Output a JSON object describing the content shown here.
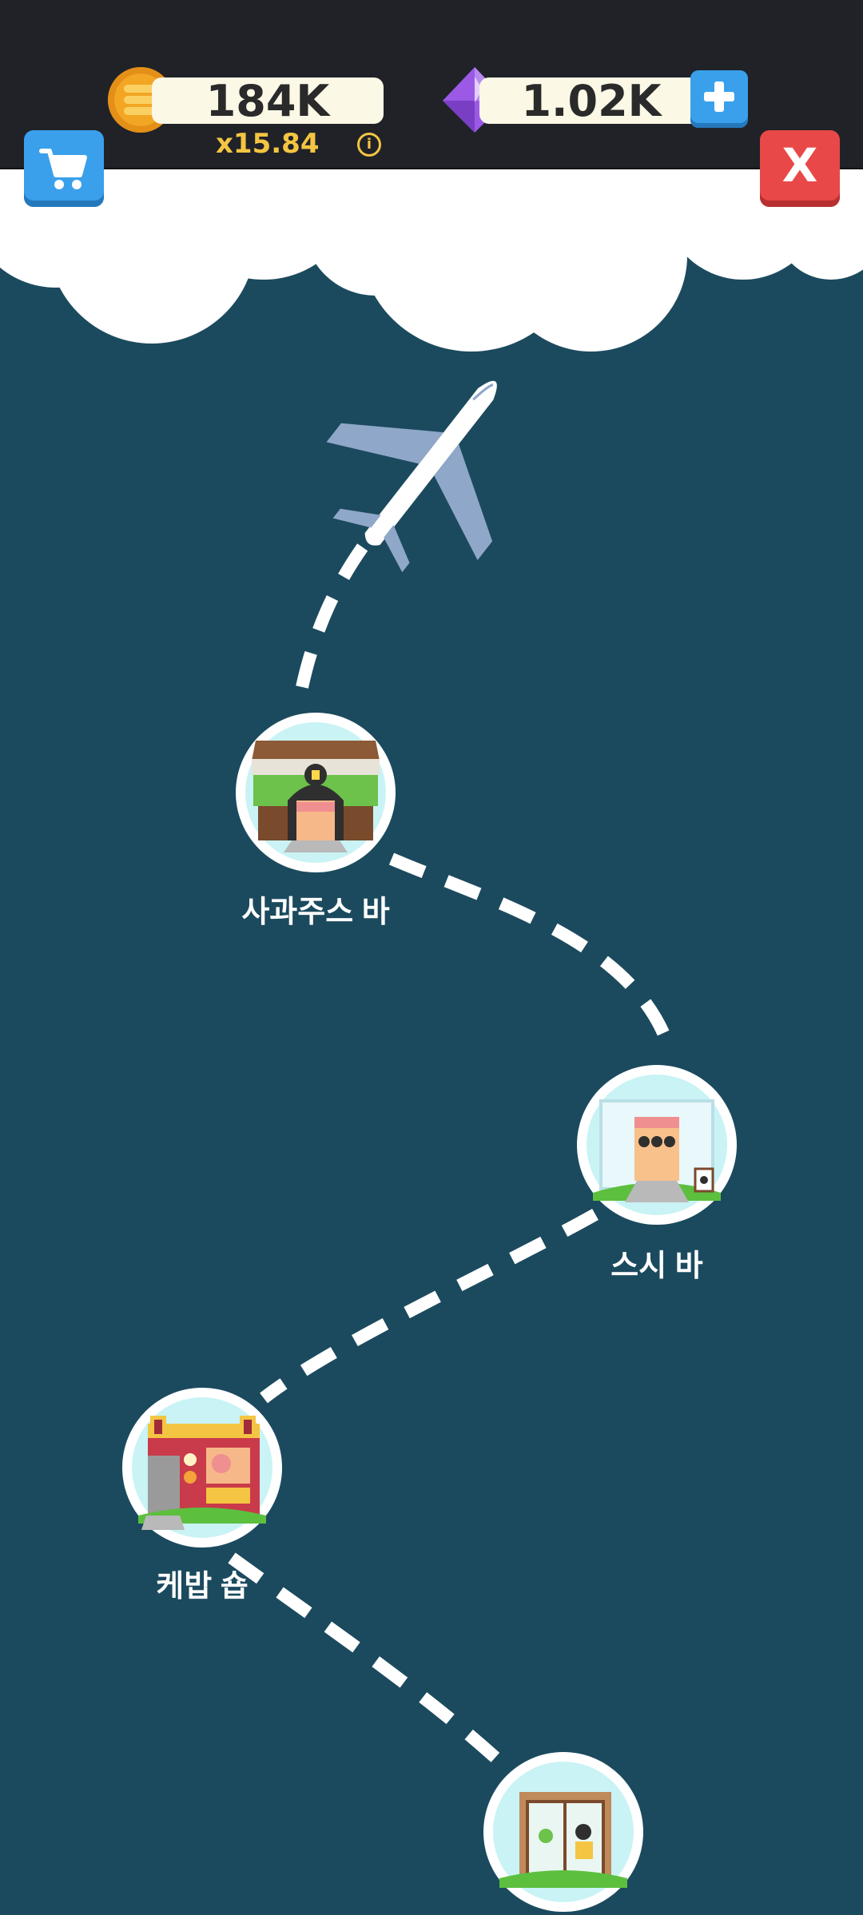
{
  "hud": {
    "coins": "184K",
    "multiplier": "x15.84",
    "gems": "1.02K",
    "info_glyph": "i",
    "close_label": "X"
  },
  "stations": [
    {
      "label": "사과주스 바",
      "icon": "juice-bar-building-icon"
    },
    {
      "label": "스시 바",
      "icon": "sushi-bar-building-icon"
    },
    {
      "label": "케밥 숍",
      "icon": "kebab-shop-building-icon"
    },
    {
      "label": "",
      "icon": "next-shop-building-icon"
    }
  ],
  "colors": {
    "sea": "#1b4a5e",
    "topbar": "#202228",
    "button_blue": "#3aa0ec",
    "button_red": "#e94848",
    "coin": "#f2a623",
    "gem": "#9b59e6",
    "path": "#ffffff"
  }
}
